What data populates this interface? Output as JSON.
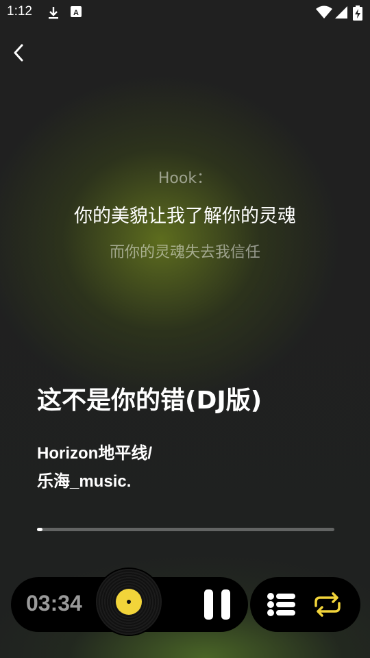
{
  "status_bar": {
    "time": "1:12",
    "icons": [
      "download-icon",
      "keyboard-a-icon",
      "wifi-icon",
      "signal-icon",
      "battery-icon"
    ]
  },
  "nav": {
    "back_icon": "chevron-left-icon"
  },
  "lyrics": {
    "previous": "Hook：",
    "current": "你的美貌让我了解你的灵魂",
    "next": "而你的灵魂失去我信任"
  },
  "song": {
    "title": "这不是你的错(DJ版)",
    "artist_line1": "Horizon地平线/",
    "artist_line2": "乐海_music."
  },
  "progress": {
    "fraction": 0.018
  },
  "player": {
    "elapsed": "03:34",
    "disc_label_color": "#f2d43a",
    "pause_icon": "pause-icon"
  },
  "controls": {
    "playlist_icon": "playlist-icon",
    "repeat_icon": "repeat-icon",
    "repeat_color": "#f2d43a"
  }
}
